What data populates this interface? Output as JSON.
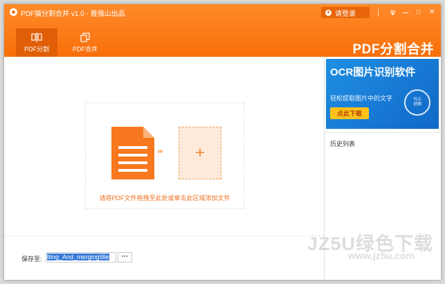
{
  "app": {
    "title": "PDF猫分割合并 v1.0 - 普强山出品"
  },
  "titlebar": {
    "login_label": "请登录",
    "menu_icon": "menu-icon",
    "minimize_glyph": "—",
    "maximize_glyph": "□",
    "close_glyph": "✕"
  },
  "tabs": [
    {
      "label": "PDF分割",
      "icon": "split-icon",
      "active": true
    },
    {
      "label": "PDF合并",
      "icon": "merge-icon",
      "active": false
    }
  ],
  "brand": {
    "title": "PDF分割合并"
  },
  "dropzone": {
    "arrows": "»»",
    "plus": "+",
    "hint": "请将PDF文件拖拽至此处或单击此区域添加文件"
  },
  "save": {
    "label": "保存至:",
    "path": "tting_And_merging\\file",
    "browse_label": "···"
  },
  "sidebar": {
    "ad": {
      "title": "OCR图片识别软件",
      "subtitle": "轻松提取图片中的文字",
      "button": "点此下载",
      "badge": "马上识图"
    },
    "history_title": "历史列表"
  },
  "watermark": {
    "text": "JZ5U绿色下载",
    "url": "www.jz5u.com"
  },
  "colors": {
    "accent": "#f77a1a",
    "accent_dark": "#e05f06",
    "ad_blue": "#1a7ed8",
    "ad_button": "#ffc21a"
  }
}
